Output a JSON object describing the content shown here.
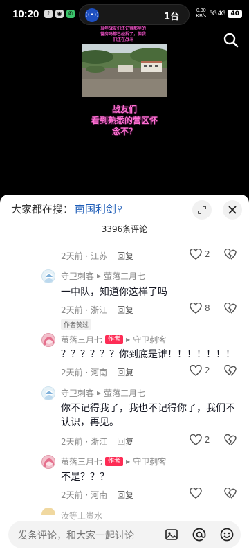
{
  "status_bar": {
    "time": "10:20",
    "pill_text": "1台",
    "net_speed": "0.30",
    "net_unit": "KB/s",
    "signal": "5G  4G",
    "battery": "40"
  },
  "video": {
    "caption_top": "当年战友们还记得那里的营房吗都已经拆了，但我们还在战斗",
    "title_line1": "战友们",
    "title_line2": "看到熟悉的营区怀",
    "title_line3": "念不？"
  },
  "sheet": {
    "search_prefix": "大家都在搜：",
    "search_link": "南国利剑",
    "comment_count": "3396条评论",
    "input_placeholder": "发条评论，和大家一起讨论"
  },
  "comments": [
    {
      "meta_time": "2天前 · 江苏",
      "reply": "回复",
      "likes": "2"
    },
    {
      "user": "守卫刺客",
      "reply_to": "萤落三月七",
      "text": "一中队，知道你这样了吗",
      "meta_time": "2天前 · 浙江",
      "reply": "回复",
      "likes": "8",
      "badge": "作者赞过"
    },
    {
      "user": "萤落三月七",
      "tag": "作者",
      "reply_to": "守卫刺客",
      "text": "？？？？？？你到底是谁！！！！！！！",
      "meta_time": "2天前 · 河南",
      "reply": "回复",
      "likes": "2"
    },
    {
      "user": "守卫刺客",
      "reply_to": "萤落三月七",
      "text": "你不记得我了，我也不记得你了，我们不认识，再见。",
      "meta_time": "2天前 · 浙江",
      "reply": "回复",
      "likes": "2"
    },
    {
      "user": "萤落三月七",
      "tag": "作者",
      "reply_to": "守卫刺客",
      "text": "不是？？？",
      "meta_time": "2天前 · 河南",
      "reply": "回复",
      "likes": ""
    }
  ],
  "partial_next_user": "汝等上贵水",
  "colors": {
    "author_tag": "#fe2c55",
    "link": "#1f5eb8",
    "video_title": "#ff6fd3"
  },
  "icons": [
    "search-icon",
    "expand-icon",
    "close-icon",
    "heart-icon",
    "broken-heart-icon",
    "image-icon",
    "at-icon",
    "emoji-icon"
  ]
}
